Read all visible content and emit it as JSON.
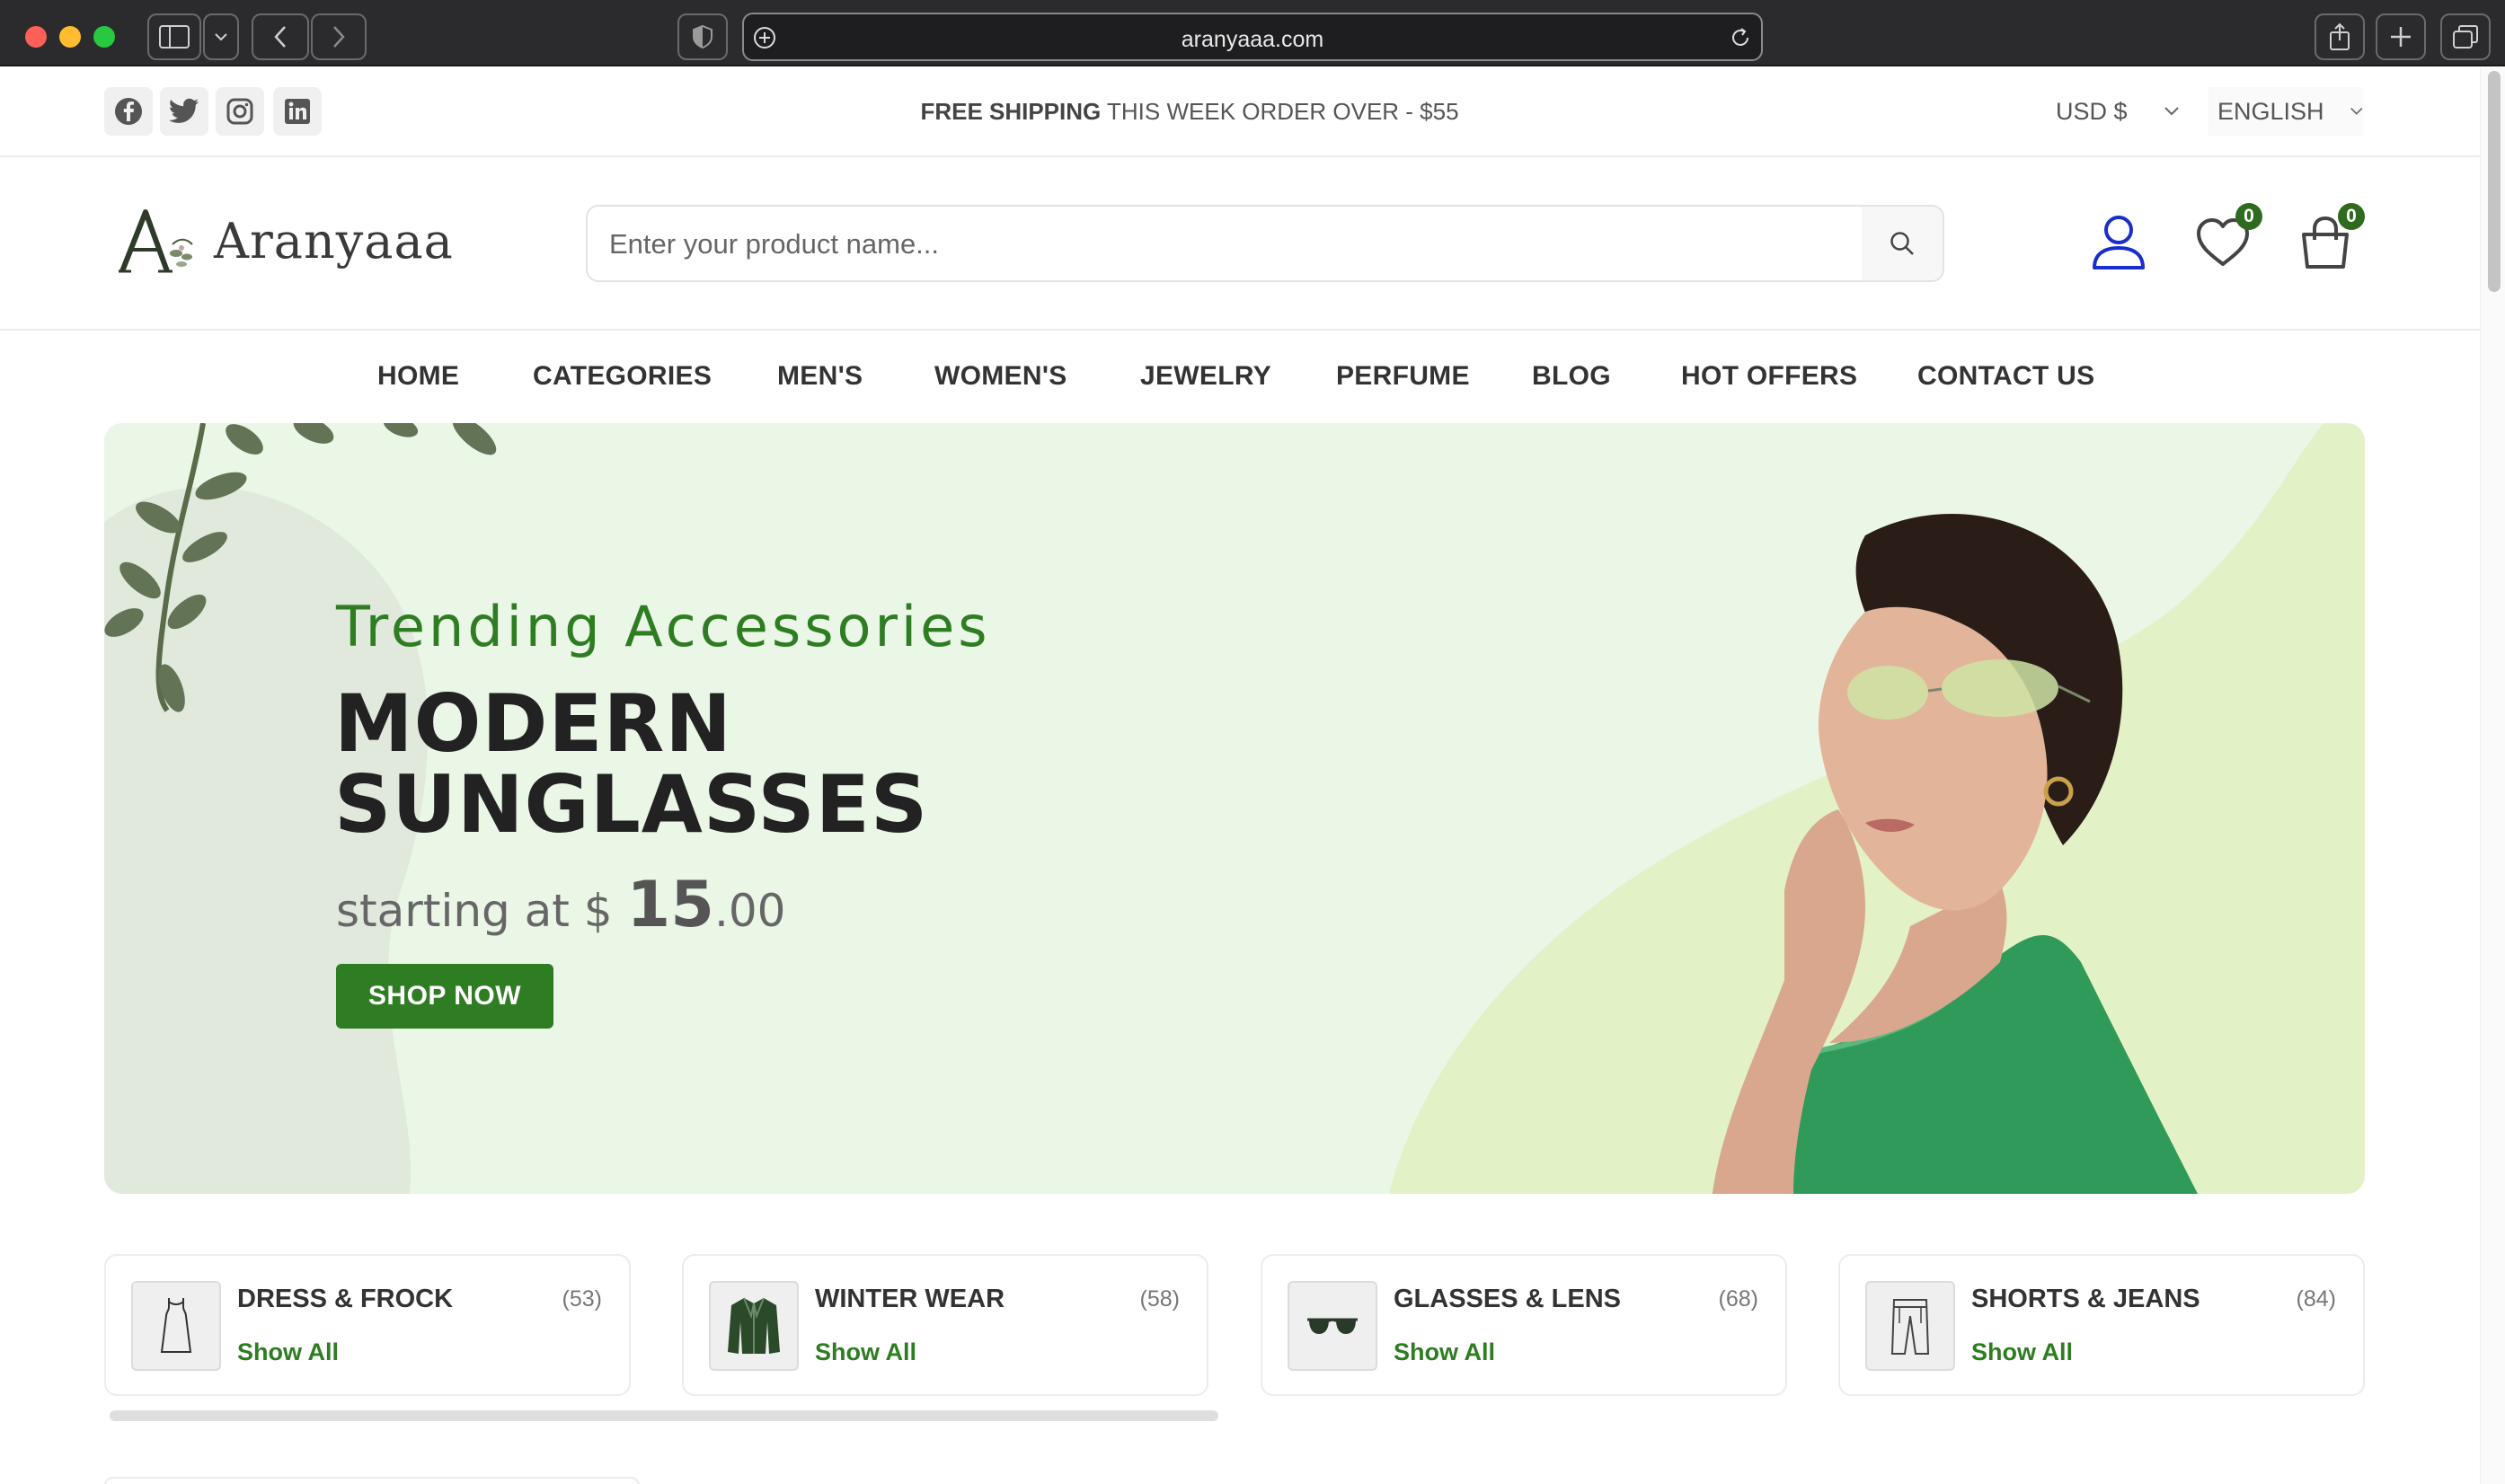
{
  "browser": {
    "url": "aranyaaa.com"
  },
  "topbar": {
    "social": [
      "facebook-icon",
      "twitter-icon",
      "instagram-icon",
      "linkedin-icon"
    ],
    "shipping_bold": "FREE SHIPPING",
    "shipping_rest": " THIS WEEK ORDER OVER - $55",
    "currency": "USD $",
    "language": "ENGLISH"
  },
  "header": {
    "logo_text": "Aranyaaa",
    "search_placeholder": "Enter your product name...",
    "wishlist_count": "0",
    "cart_count": "0"
  },
  "nav": {
    "items": [
      "HOME",
      "CATEGORIES",
      "MEN'S",
      "WOMEN'S",
      "JEWELRY",
      "PERFUME",
      "BLOG",
      "HOT OFFERS",
      "CONTACT US"
    ]
  },
  "banner": {
    "subtitle": "Trending Accessories",
    "title_line1": "MODERN",
    "title_line2": "SUNGLASSES",
    "price_prefix": "starting at $ ",
    "price_whole": "15",
    "price_cents": ".00",
    "button": "SHOP NOW"
  },
  "categories": [
    {
      "name": "DRESS & FROCK",
      "count": "(53)",
      "link": "Show All",
      "icon": "dress-icon"
    },
    {
      "name": "WINTER WEAR",
      "count": "(58)",
      "link": "Show All",
      "icon": "jacket-icon"
    },
    {
      "name": "GLASSES & LENS",
      "count": "(68)",
      "link": "Show All",
      "icon": "glasses-icon"
    },
    {
      "name": "SHORTS & JEANS",
      "count": "(84)",
      "link": "Show All",
      "icon": "jeans-icon"
    }
  ],
  "colors": {
    "accent": "#2e7d22",
    "banner_bg": "#eaf6e6",
    "badge": "#2e6b1e",
    "user_icon": "#1a2ecc"
  }
}
